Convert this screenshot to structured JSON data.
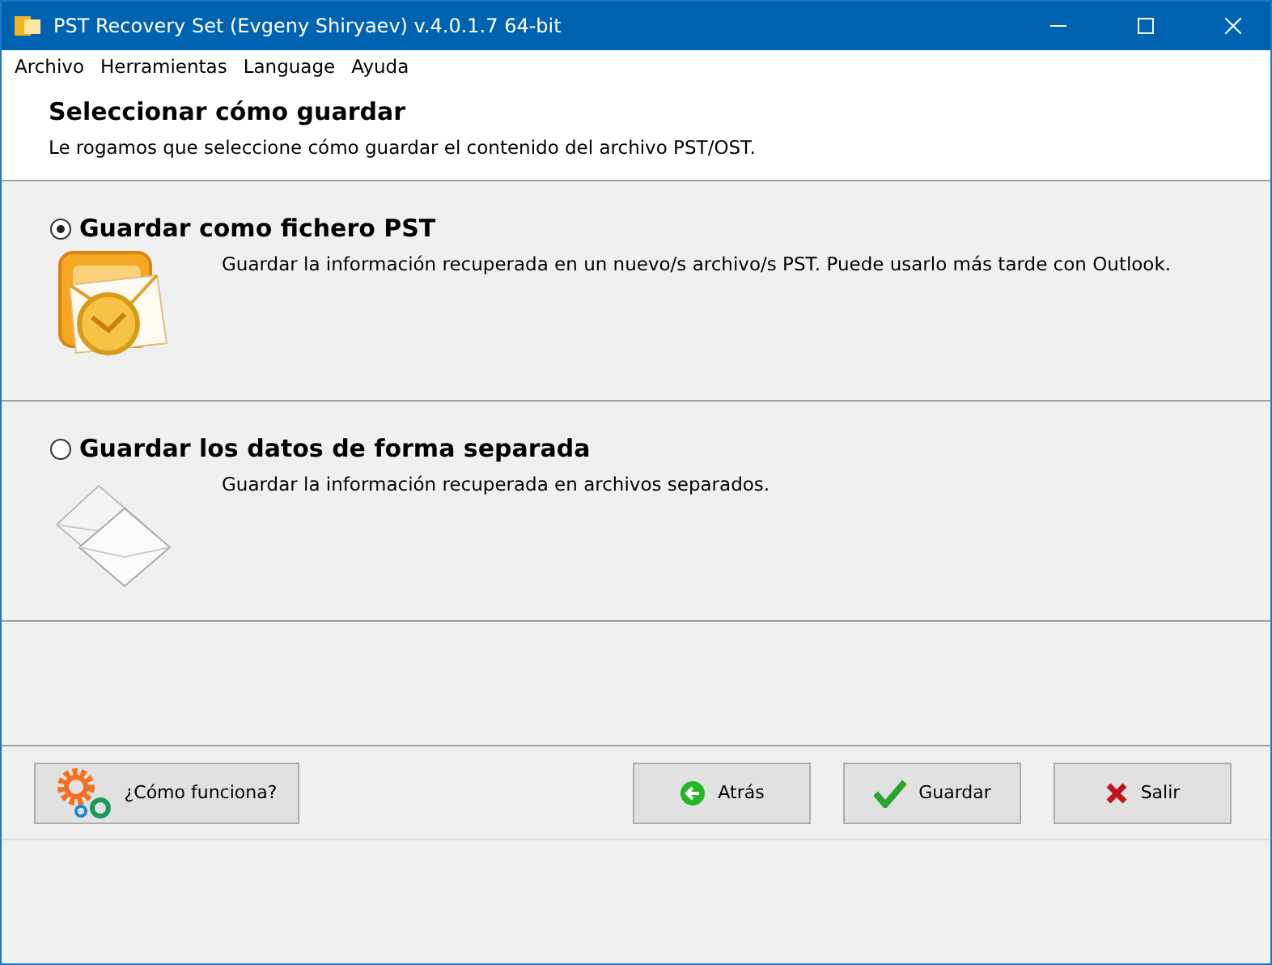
{
  "window": {
    "title": "PST Recovery Set (Evgeny Shiryaev) v.4.0.1.7 64-bit"
  },
  "menu": [
    "Archivo",
    "Herramientas",
    "Language",
    "Ayuda"
  ],
  "header": {
    "title": "Seleccionar cómo guardar",
    "subtitle": "Le rogamos que seleccione cómo guardar el contenido del archivo PST/OST."
  },
  "options": [
    {
      "kind": "pst",
      "label": "Guardar como fichero PST",
      "description": "Guardar la información recuperada en un nuevo/s archivo/s PST. Puede usarlo más tarde con Outlook.",
      "selected": true
    },
    {
      "kind": "separate",
      "label": "Guardar los datos de forma separada",
      "description": "Guardar la información recuperada en archivos separados.",
      "selected": false
    }
  ],
  "buttons": [
    {
      "kind": "help",
      "label": "¿Cómo funciona?"
    },
    {
      "kind": "back",
      "label": "Atrás"
    },
    {
      "kind": "save",
      "label": "Guardar"
    },
    {
      "kind": "exit",
      "label": "Salir"
    }
  ]
}
